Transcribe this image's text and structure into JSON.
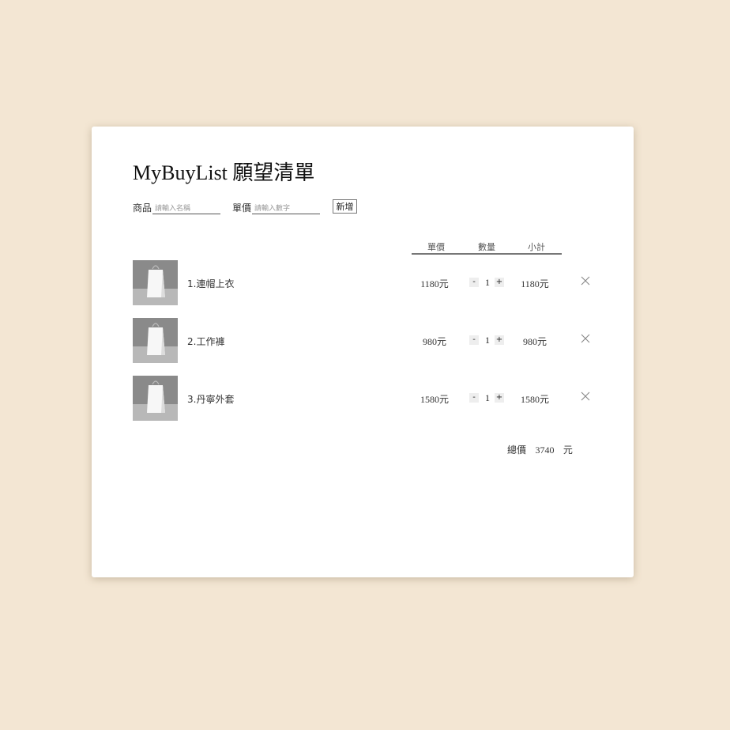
{
  "app": {
    "title": "MyBuyList 願望清單"
  },
  "form": {
    "product_label": "商品",
    "product_placeholder": "請輸入名稱",
    "price_label": "單價",
    "price_placeholder": "請輸入數字",
    "add_label": "新增"
  },
  "table": {
    "headers": {
      "price": "單價",
      "qty": "數量",
      "subtotal": "小計"
    },
    "items": [
      {
        "name": "1.連帽上衣",
        "price": "1180元",
        "qty": "1",
        "subtotal": "1180元",
        "icon": "shopping-bag-icon"
      },
      {
        "name": "2.工作褲",
        "price": "980元",
        "qty": "1",
        "subtotal": "980元",
        "icon": "shopping-bag-icon"
      },
      {
        "name": "3.丹寧外套",
        "price": "1580元",
        "qty": "1",
        "subtotal": "1580元",
        "icon": "shopping-bag-icon"
      }
    ],
    "minus_label": "-",
    "plus_label": "+"
  },
  "total": {
    "label": "總價",
    "value": "3740",
    "unit": "元"
  },
  "colors": {
    "background": "#f3e6d3",
    "card": "#ffffff",
    "header_line": "#777777"
  }
}
